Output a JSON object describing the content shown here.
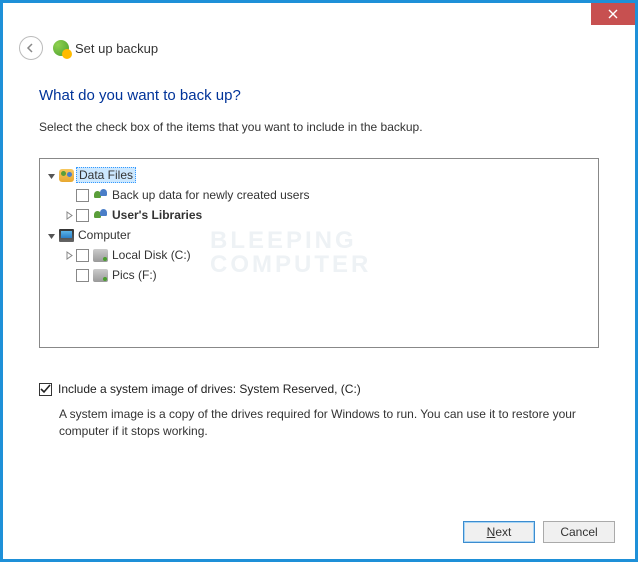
{
  "window": {
    "title": "Set up backup"
  },
  "main": {
    "heading": "What do you want to back up?",
    "subtext": "Select the check box of the items that you want to include in the backup.",
    "watermark_line1": "BLEEPING",
    "watermark_line2": "COMPUTER"
  },
  "tree": {
    "data_files": {
      "label": "Data Files",
      "backup_new_users": "Back up data for newly created users",
      "users_libraries": "User's Libraries"
    },
    "computer": {
      "label": "Computer",
      "local_disk": "Local Disk (C:)",
      "pics_disk": "Pics (F:)"
    }
  },
  "system_image": {
    "checkbox_label": "Include a system image of drives: System Reserved, (C:)",
    "description": "A system image is a copy of the drives required for Windows to run. You can use it to restore your computer if it stops working."
  },
  "footer": {
    "next": "Next",
    "cancel": "Cancel"
  }
}
